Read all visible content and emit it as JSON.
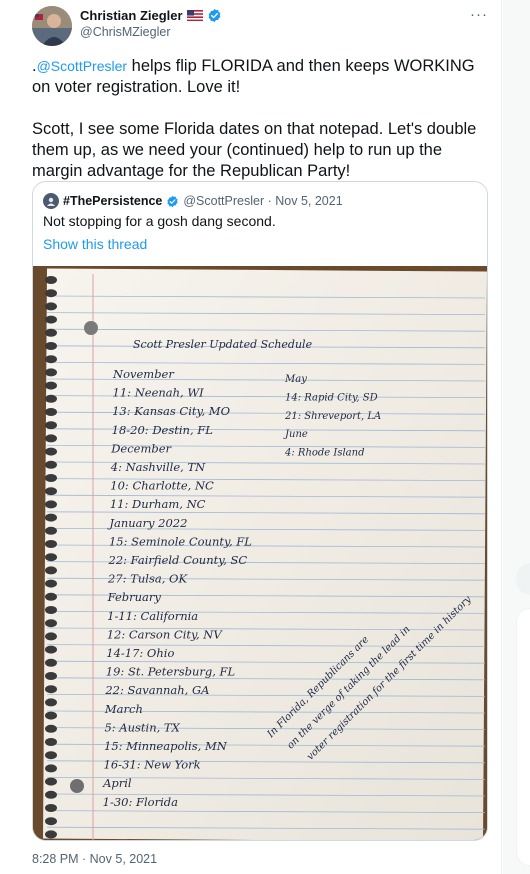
{
  "tweet": {
    "author_name": "Christian Ziegler",
    "author_handle": "@ChrisMZiegler",
    "more_icon": "more-icon",
    "text_prefix": ".",
    "mention": "@ScottPresler",
    "text_line1_rest": " helps flip FLORIDA and then keeps WORKING on voter registration. Love it!",
    "text_para2": "Scott, I see some Florida dates on that notepad. Let's double them up, as we need your (continued) help to run up the margin advantage for the Republican Party!",
    "timestamp": "8:28 PM · Nov 5, 2021"
  },
  "quote": {
    "name": "#ThePersistence",
    "handle_date": "@ScottPresler · Nov 5, 2021",
    "text": "Not stopping for a gosh dang second.",
    "show_thread": "Show this thread"
  },
  "notepad": {
    "title": "Scott Presler Updated Schedule",
    "left_column": [
      "November",
      "11: Neenah, WI",
      "13: Kansas City, MO",
      "18-20: Destin, FL",
      "December",
      "4: Nashville, TN",
      "10: Charlotte, NC",
      "11: Durham, NC",
      "January 2022",
      "15: Seminole County, FL",
      "22: Fairfield County, SC",
      "27: Tulsa, OK",
      "February",
      "1-11: California",
      "12: Carson City, NV",
      "14-17: Ohio",
      "19: St. Petersburg, FL",
      "22: Savannah, GA",
      "March",
      "5: Austin, TX",
      "15: Minneapolis, MN",
      "16-31: New York",
      "April",
      "1-30: Florida"
    ],
    "right_column": [
      "May",
      "14: Rapid City, SD",
      "21: Shreveport, LA",
      "June",
      "4: Rhode Island"
    ],
    "diagonal_note": [
      "In Florida, Republicans are",
      "on the verge of taking the lead in",
      "voter registration for the first time in history"
    ]
  },
  "colors": {
    "link": "#1d9bf0",
    "verified": "#1d9bf0",
    "ink": "#1e2a44",
    "paper": "#f6f3ec",
    "rule": "#9fb8d6",
    "table": "#6a4a2c"
  }
}
